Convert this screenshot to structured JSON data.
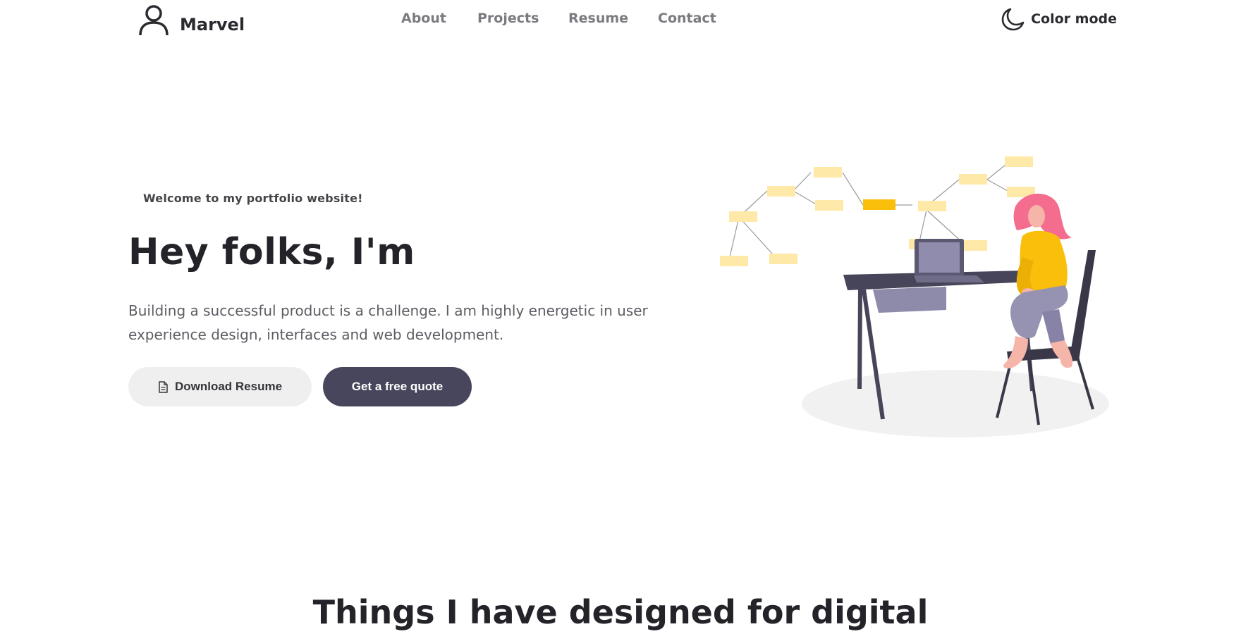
{
  "header": {
    "brand_name": "Marvel",
    "brand_icon": "user-icon",
    "nav": [
      "About",
      "Projects",
      "Resume",
      "Contact"
    ],
    "color_mode_label": "Color mode",
    "color_mode_icon": "moon-icon"
  },
  "hero": {
    "welcome": "Welcome to my portfolio website!",
    "title": "Hey folks, I'm",
    "description": "Building a successful product is a challenge. I am highly energetic in user experience design, interfaces and web development.",
    "primary_button": "Download Resume",
    "primary_button_icon": "document-icon",
    "secondary_button": "Get a free quote",
    "illustration": "woman-at-desk-with-laptop-illustration"
  },
  "section": {
    "title": "Things I have designed for digital"
  },
  "colors": {
    "background": "#ffffff",
    "text_dark": "#232329",
    "text_muted": "#7a7a80",
    "button_light": "#efefef",
    "button_dark": "#48465c",
    "accent_yellow": "#f9bf0a",
    "accent_pink": "#f46d8e"
  }
}
